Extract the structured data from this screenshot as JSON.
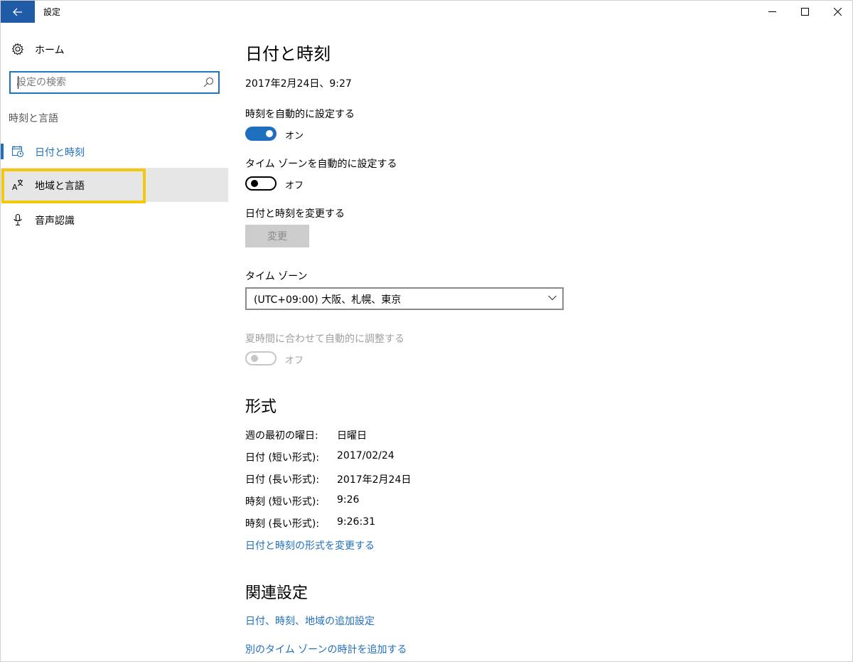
{
  "window": {
    "title": "設定",
    "back_icon": "arrow-left-icon",
    "controls": [
      "minimize-icon",
      "maximize-icon",
      "close-icon"
    ]
  },
  "sidebar": {
    "home_label": "ホーム",
    "home_icon": "gear-icon",
    "search_placeholder": "設定の検索",
    "search_icon": "search-icon",
    "section_label": "時刻と言語",
    "items": [
      {
        "label": "日付と時刻",
        "icon": "calendar-clock-icon",
        "selected": true
      },
      {
        "label": "地域と言語",
        "icon": "language-icon",
        "hovered": true
      },
      {
        "label": "音声認識",
        "icon": "microphone-icon"
      }
    ]
  },
  "main": {
    "title": "日付と時刻",
    "current_datetime": "2017年2月24日、9:27",
    "auto_time": {
      "label": "時刻を自動的に設定する",
      "state": "オン",
      "on": true
    },
    "auto_timezone": {
      "label": "タイム ゾーンを自動的に設定する",
      "state": "オフ",
      "on": false
    },
    "change_datetime": {
      "label": "日付と時刻を変更する",
      "button": "変更"
    },
    "timezone": {
      "label": "タイム ゾーン",
      "value": "(UTC+09:00) 大阪、札幌、東京"
    },
    "dst": {
      "label": "夏時間に合わせて自動的に調整する",
      "state": "オフ",
      "disabled": true
    },
    "format": {
      "title": "形式",
      "rows": [
        {
          "key": "週の最初の曜日:",
          "value": "日曜日"
        },
        {
          "key": "日付 (短い形式):",
          "value": "2017/02/24"
        },
        {
          "key": "日付 (長い形式):",
          "value": "2017年2月24日"
        },
        {
          "key": "時刻 (短い形式):",
          "value": "9:26"
        },
        {
          "key": "時刻 (長い形式):",
          "value": "9:26:31"
        }
      ],
      "change_link": "日付と時刻の形式を変更する"
    },
    "related": {
      "title": "関連設定",
      "links": [
        "日付、時刻、地域の追加設定",
        "別のタイム ゾーンの時計を追加する"
      ]
    }
  },
  "colors": {
    "accent": "#1f6fbf",
    "highlight_border": "#f4c90d",
    "hover_bg": "#e6e6e6"
  }
}
